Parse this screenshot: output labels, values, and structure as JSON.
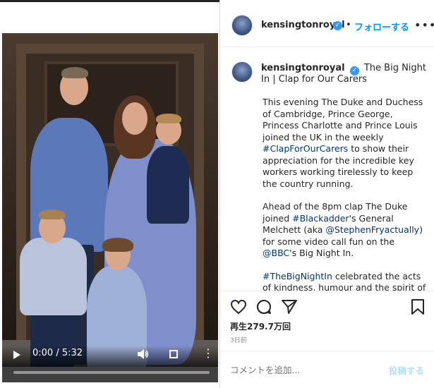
{
  "header": {
    "username": "kensingtonroyal",
    "separator": "•",
    "follow_label": "フォローする",
    "more_label": "•••"
  },
  "caption": {
    "username": "kensingtonroyal",
    "title": "The Big Night In | Clap for Our Carers",
    "para1_a": "This evening The Duke and Duchess of Cambridge, Prince George, Princess Charlotte and Prince Louis joined the UK in the weekly ",
    "para1_tag": "#ClapForOurCarers",
    "para1_b": " to show their appreciation for the incredible key workers working tirelessly to keep the country running.",
    "para2_a": "Ahead of the 8pm clap The Duke joined ",
    "para2_tag1": "#Blackadder",
    "para2_b": "'s General Melchett (aka ",
    "para2_tag2": "@StephenFryactually",
    "para2_c": ") for some video call fun on the ",
    "para2_tag3": "@BBC",
    "para2_d": "'s Big Night In.",
    "para3_tag": "#TheBigNightIn",
    "para3_a": " celebrated the acts of kindness, humour and the spirit of hope and resilience that is keeping the"
  },
  "video": {
    "time": "0:00 / 5:32"
  },
  "stats": {
    "views": "再生279.7万回",
    "date": "3日前"
  },
  "comment": {
    "placeholder": "コメントを追加...",
    "post_label": "投稿する"
  },
  "icons": [
    "heart-icon",
    "comment-icon",
    "share-icon",
    "bookmark-icon",
    "play-icon",
    "volume-icon",
    "fullscreen-icon",
    "more-icon",
    "verified-icon"
  ],
  "colors": {
    "accent": "#0095f6",
    "verified": "#3897f0",
    "hashtag": "#00376b",
    "muted": "#8e8e8e"
  }
}
